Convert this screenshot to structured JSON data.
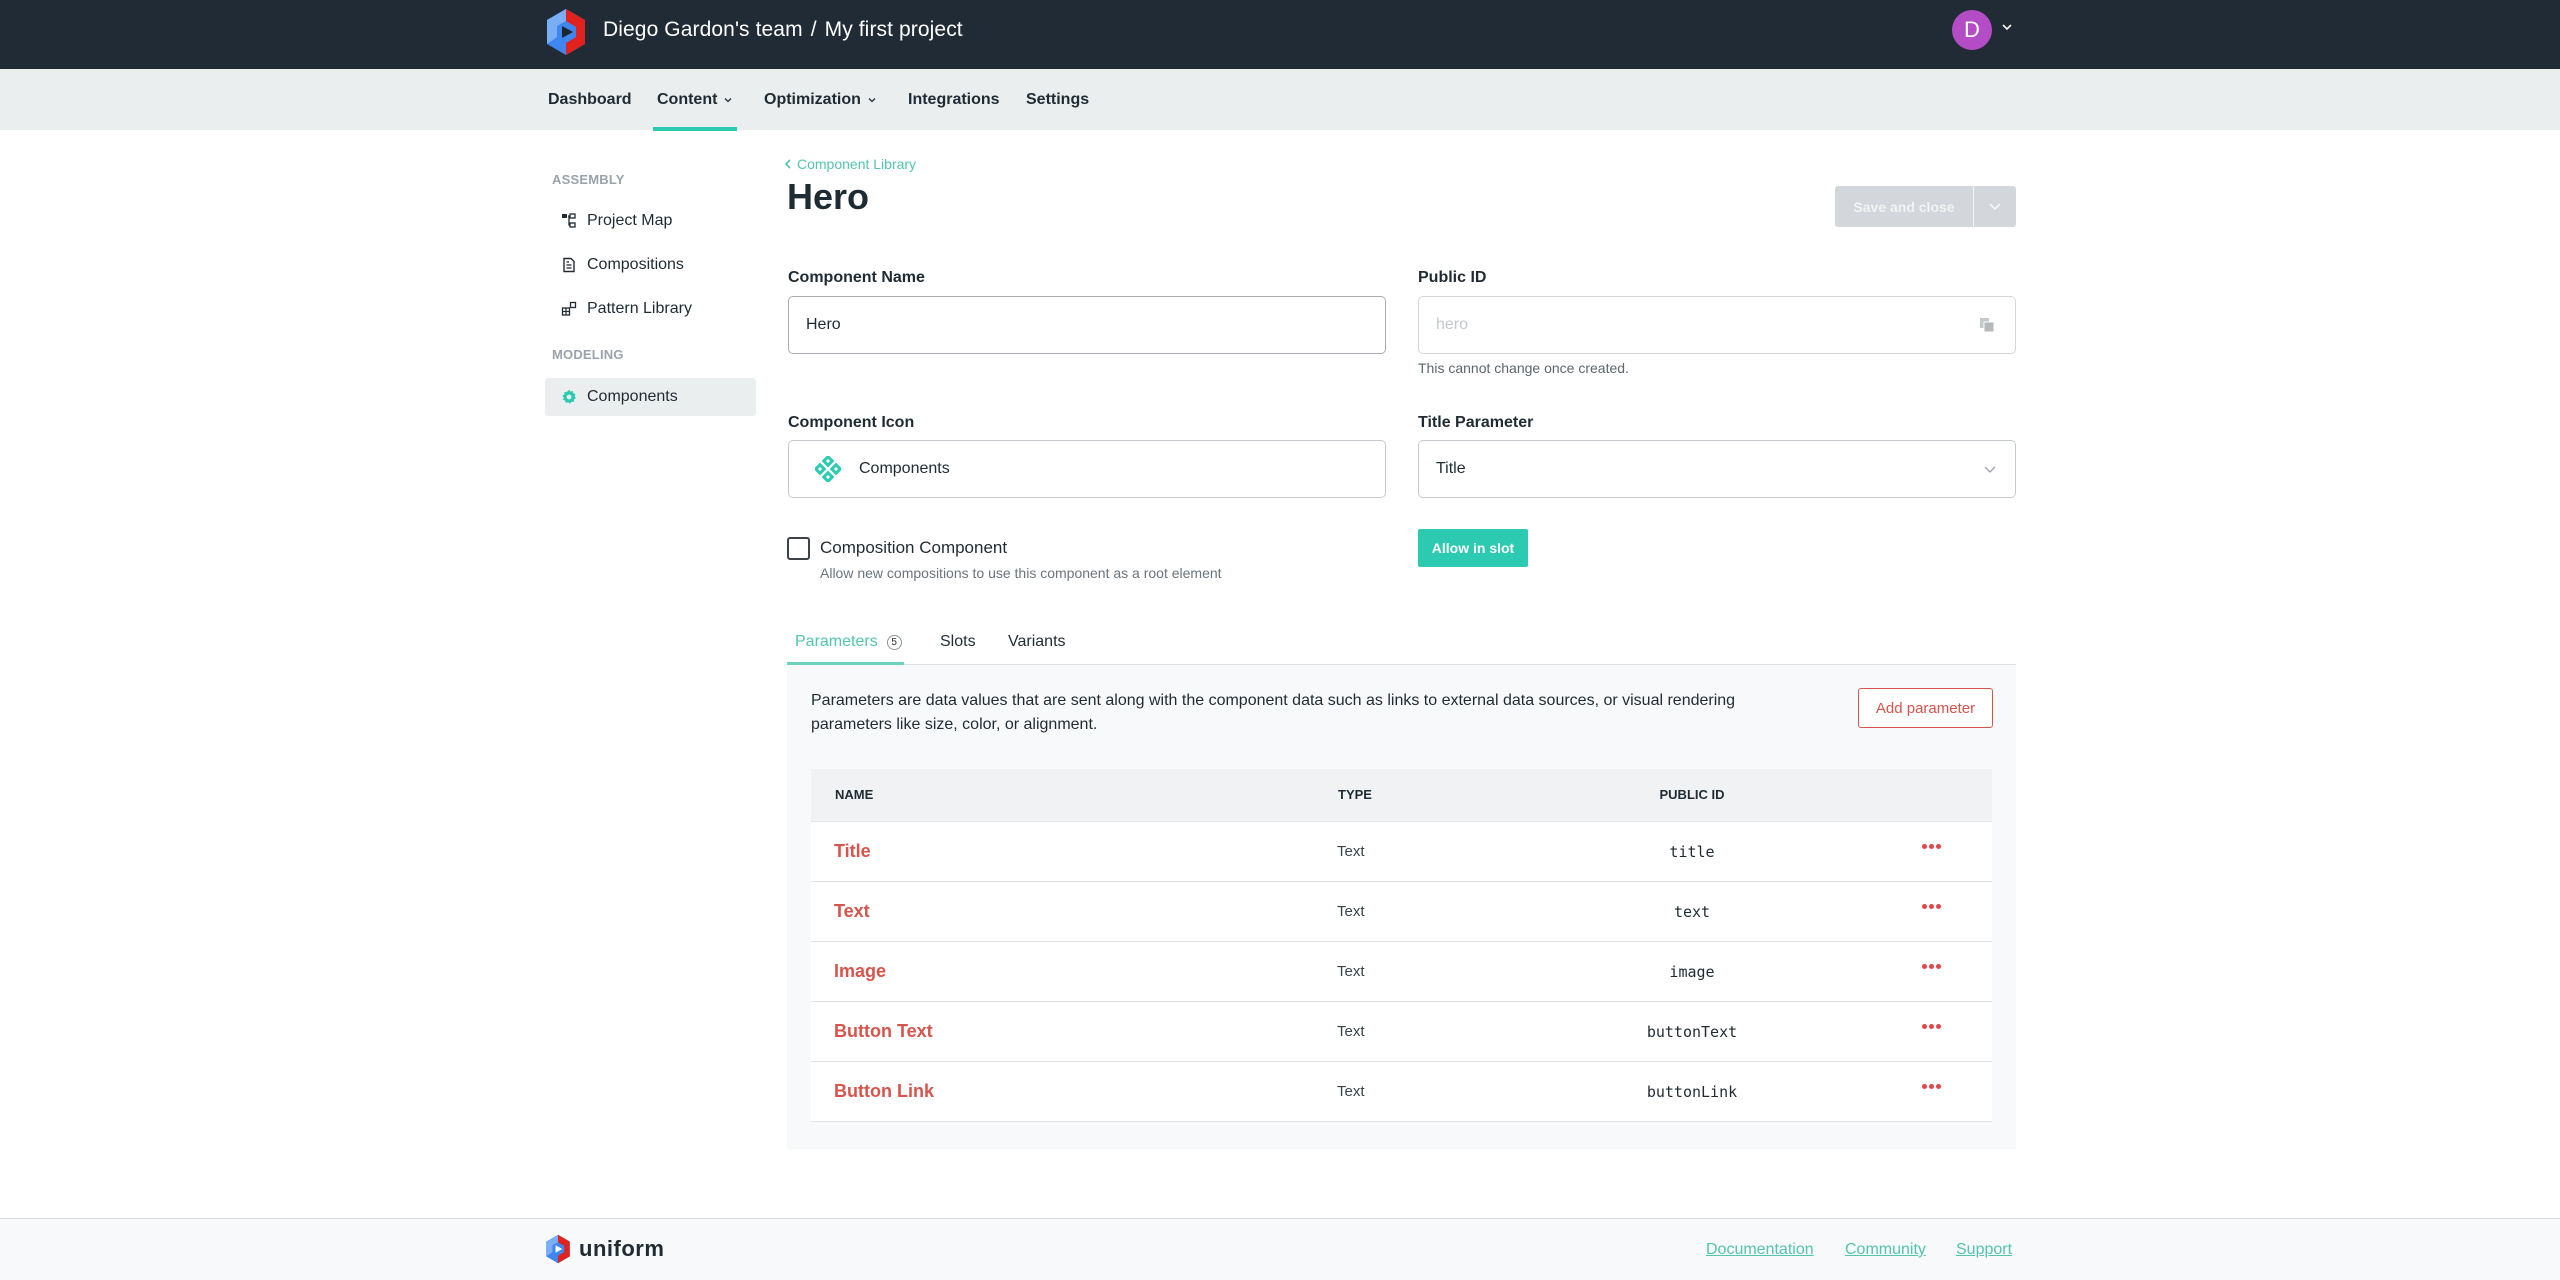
{
  "header": {
    "team": "Diego Gardon's team",
    "separator": "/",
    "project": "My first project",
    "avatar_initial": "D",
    "avatar_color": "#b44dc5"
  },
  "nav": {
    "items": [
      {
        "label": "Dashboard",
        "has_menu": false,
        "active": false
      },
      {
        "label": "Content",
        "has_menu": true,
        "active": true
      },
      {
        "label": "Optimization",
        "has_menu": true,
        "active": false
      },
      {
        "label": "Integrations",
        "has_menu": false,
        "active": false
      },
      {
        "label": "Settings",
        "has_menu": false,
        "active": false
      }
    ]
  },
  "sidebar": {
    "sections": [
      {
        "title": "ASSEMBLY",
        "items": [
          {
            "label": "Project Map",
            "icon": "project-map-icon"
          },
          {
            "label": "Compositions",
            "icon": "document-icon"
          },
          {
            "label": "Pattern Library",
            "icon": "pattern-library-icon"
          }
        ]
      },
      {
        "title": "MODELING",
        "items": [
          {
            "label": "Components",
            "icon": "gear-icon",
            "active": true
          }
        ]
      }
    ]
  },
  "page": {
    "breadcrumb": "Component Library",
    "title": "Hero",
    "save_label": "Save and close"
  },
  "form": {
    "component_name": {
      "label": "Component Name",
      "value": "Hero"
    },
    "public_id": {
      "label": "Public ID",
      "value": "hero",
      "hint": "This cannot change once created."
    },
    "component_icon": {
      "label": "Component Icon",
      "value": "Components"
    },
    "title_parameter": {
      "label": "Title Parameter",
      "value": "Title"
    },
    "composition_component": {
      "label": "Composition Component",
      "hint": "Allow new compositions to use this component as a root element",
      "checked": false
    },
    "allow_in_slot_label": "Allow in slot"
  },
  "tabs": [
    {
      "label": "Parameters",
      "count": "5",
      "active": true
    },
    {
      "label": "Slots",
      "active": false
    },
    {
      "label": "Variants",
      "active": false
    }
  ],
  "parameters": {
    "description": "Parameters are data values that are sent along with the component data such as links to external data sources, or visual rendering parameters like size, color, or alignment.",
    "add_label": "Add parameter",
    "columns": [
      "NAME",
      "TYPE",
      "PUBLIC ID"
    ],
    "rows": [
      {
        "name": "Title",
        "type": "Text",
        "public_id": "title"
      },
      {
        "name": "Text",
        "type": "Text",
        "public_id": "text"
      },
      {
        "name": "Image",
        "type": "Text",
        "public_id": "image"
      },
      {
        "name": "Button Text",
        "type": "Text",
        "public_id": "buttonText"
      },
      {
        "name": "Button Link",
        "type": "Text",
        "public_id": "buttonLink"
      }
    ]
  },
  "footer": {
    "brand": "uniform",
    "links": [
      "Documentation",
      "Community",
      "Support"
    ]
  },
  "colors": {
    "accent": "#2ccbb1",
    "danger": "#d6544b",
    "topbar": "#212b35"
  }
}
